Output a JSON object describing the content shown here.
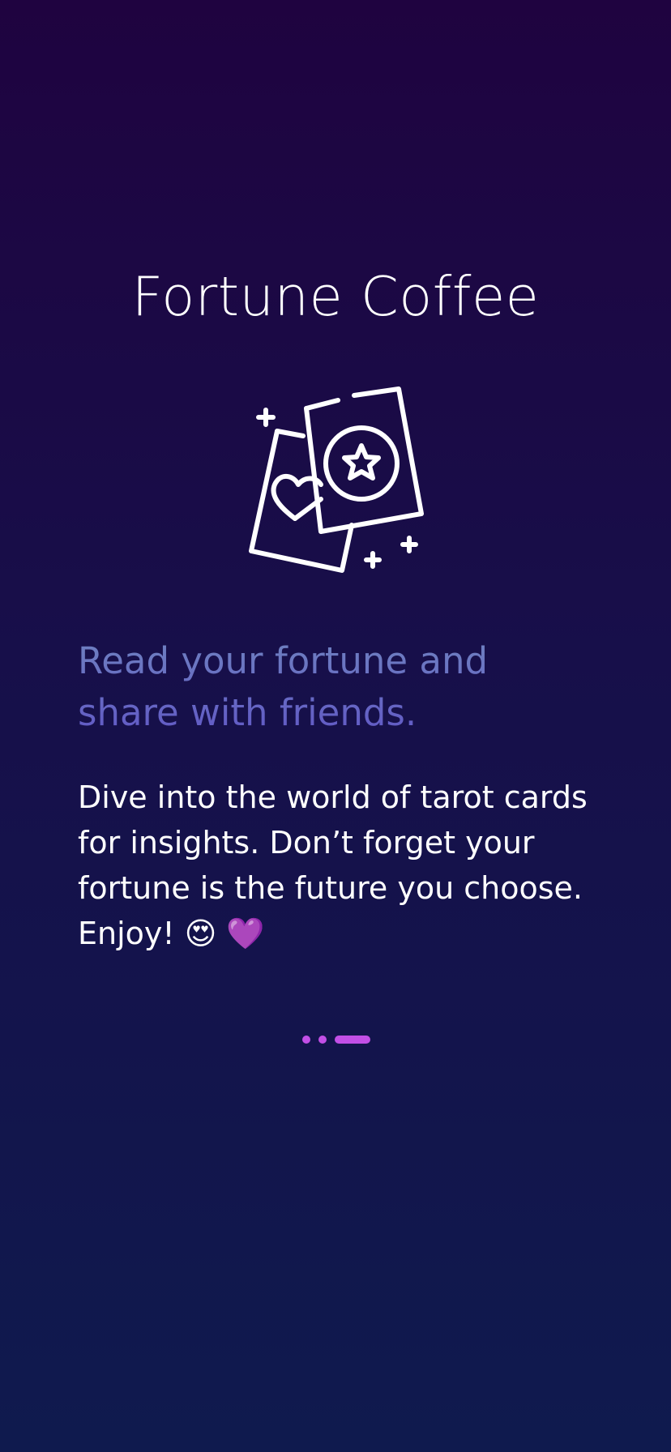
{
  "app": {
    "title": "Fortune Coffee"
  },
  "illustration": {
    "icon": "tarot-cards-icon"
  },
  "onboarding": {
    "headline": "Read your fortune and share with friends.",
    "body": "Dive into the world of tarot cards for insights. Don’t forget your fortune is the future you choose. Enjoy! 😍 💜"
  },
  "pager": {
    "total": 3,
    "current": 3,
    "color": "#c24fe6"
  },
  "colors": {
    "background_top": "#1f0340",
    "background_bottom": "#0f1a4e",
    "headline": "#6a6fc4",
    "text": "#ffffff"
  }
}
